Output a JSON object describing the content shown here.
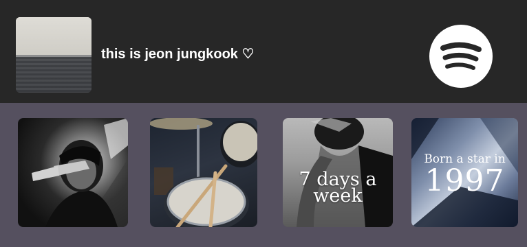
{
  "playlist": {
    "title": "this is jeon jungkook ♡"
  },
  "brand": {
    "icon": "spotify-icon",
    "color": "#ffffff",
    "logo_color": "#272727"
  },
  "colors": {
    "header_bg": "#272727",
    "body_bg": "#55505f",
    "text": "#ffffff"
  },
  "tiles": [
    {
      "id": "tile-1",
      "text": ""
    },
    {
      "id": "tile-2",
      "text": ""
    },
    {
      "id": "tile-3",
      "text": "7 days a week"
    },
    {
      "id": "tile-4",
      "line1": "Born a star in",
      "line2": "1997"
    }
  ]
}
